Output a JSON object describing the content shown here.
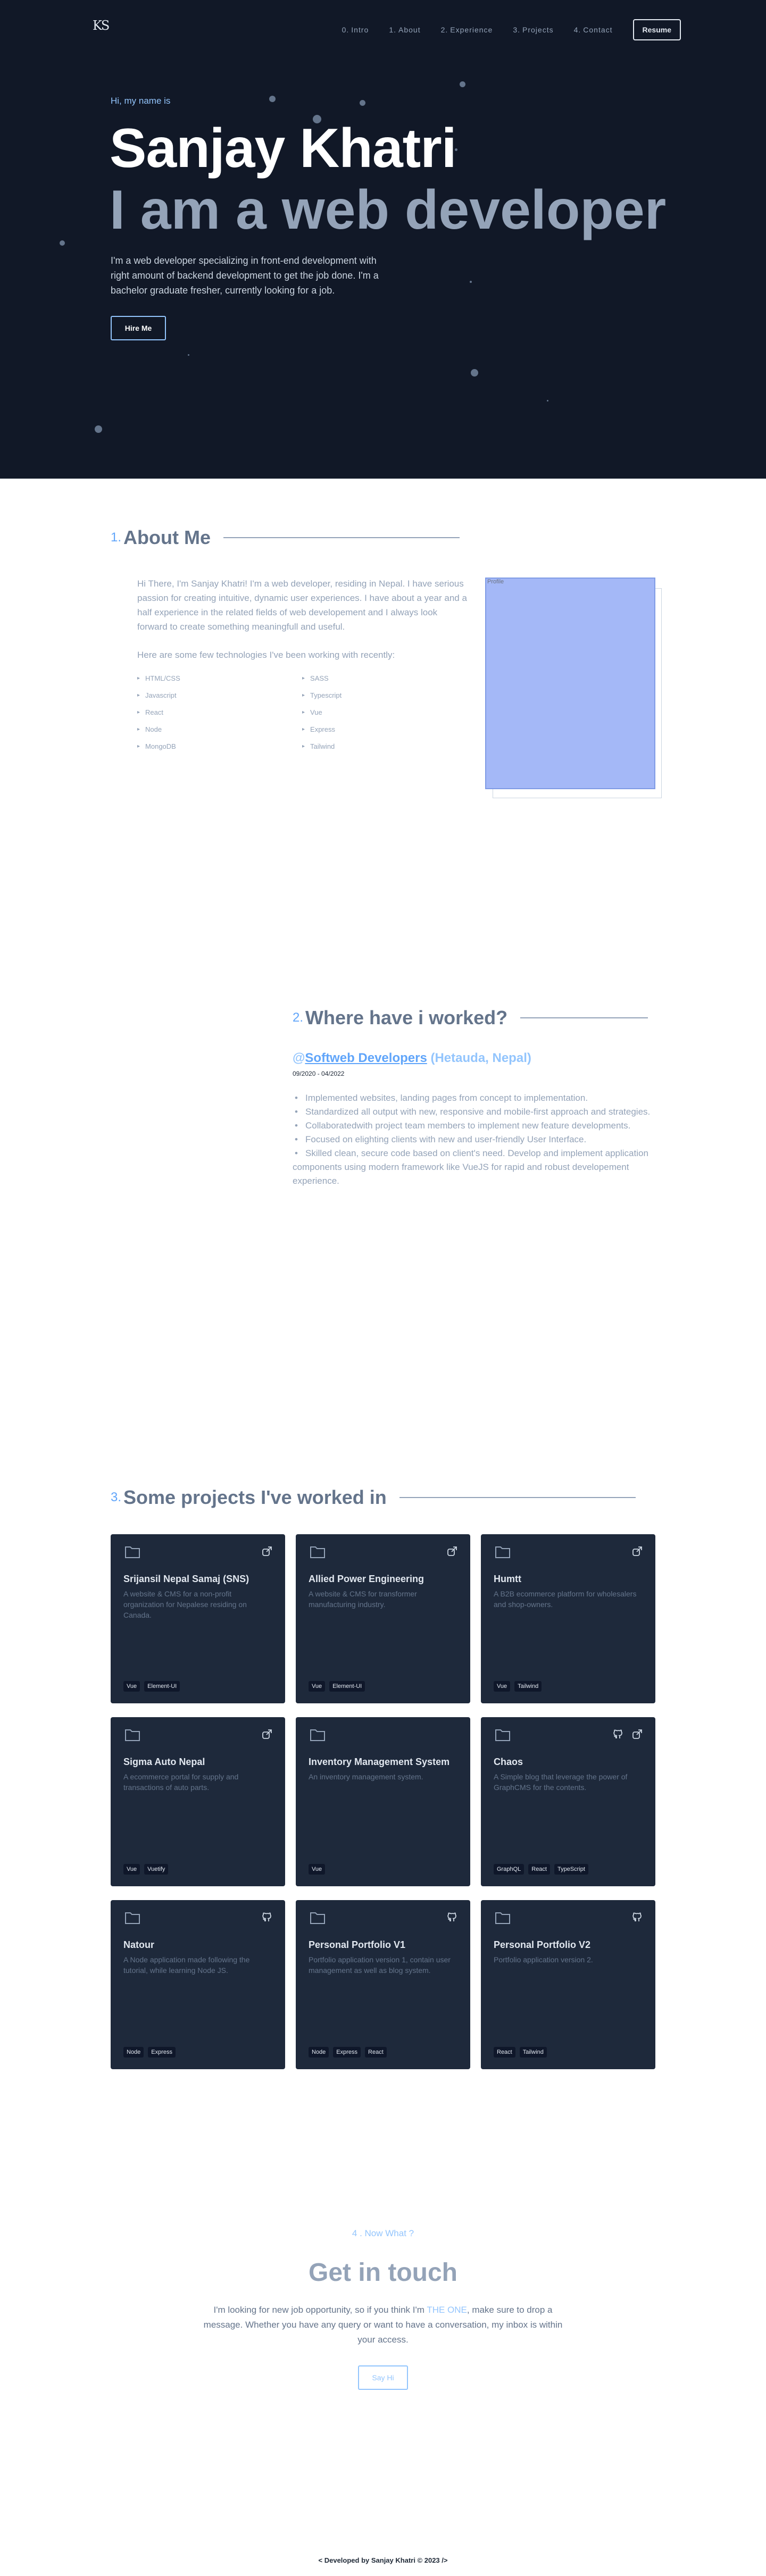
{
  "nav": {
    "logo": "KS",
    "links": [
      {
        "num": "0.",
        "label": "Intro"
      },
      {
        "num": "1.",
        "label": "About"
      },
      {
        "num": "2.",
        "label": "Experience"
      },
      {
        "num": "3.",
        "label": "Projects"
      },
      {
        "num": "4.",
        "label": "Contact"
      }
    ],
    "resume_label": "Resume"
  },
  "hero": {
    "intro": "Hi, my name is",
    "name": "Sanjay Khatri",
    "role": "I am a web developer",
    "description": "I'm a web developer specializing in front-end development with right amount of backend development to get the job done. I'm a bachelor graduate fresher, currently looking for a job.",
    "cta_label": "Hire Me"
  },
  "about": {
    "num": "1.",
    "title": "About Me",
    "text": "Hi There, I'm Sanjay Khatri! I'm a web developer, residing in Nepal. I have serious passion for creating intuitive, dynamic user experiences. I have about a year and a half experience in the related fields of web developement and I always look forward to create something meaningfull and useful.",
    "tech_intro": "Here are some few technologies I've been working with recently:",
    "technologies": [
      "HTML/CSS",
      "SASS",
      "Javascript",
      "Typescript",
      "React",
      "Vue",
      "Node",
      "Express",
      "MongoDB",
      "Tailwind"
    ],
    "photo_alt": "Profile"
  },
  "experience": {
    "num": "2.",
    "title": "Where have i worked?",
    "company_at": "@",
    "company_name": "Softweb Developers",
    "company_location": "(Hetauda, Nepal)",
    "period": "09/2020 - 04/2022",
    "duties": [
      "Implemented websites, landing pages from concept to implementation.",
      "Standardized all output with new, responsive and mobile-first approach and strategies.",
      "Collaboratedwith project team members to implement new feature developments.",
      "Focused on elighting clients with new and user-friendly User Interface.",
      "Skilled clean, secure code based on client's need. Develop and implement application components using modern framework like VueJS for rapid and robust developement experience."
    ]
  },
  "projects": {
    "num": "3.",
    "title": "Some projects I've worked in",
    "items": [
      {
        "title": "Srijansil Nepal Samaj (SNS)",
        "description": "A website & CMS for a non-profit organization for Nepalese residing on Canada.",
        "tags": [
          "Vue",
          "Element-UI"
        ],
        "icons": [
          "external-link-icon"
        ]
      },
      {
        "title": "Allied Power Engineering",
        "description": "A website & CMS for transformer manufacturing industry.",
        "tags": [
          "Vue",
          "Element-UI"
        ],
        "icons": [
          "external-link-icon"
        ]
      },
      {
        "title": "Humtt",
        "description": "A B2B ecommerce platform for wholesalers and shop-owners.",
        "tags": [
          "Vue",
          "Tailwind"
        ],
        "icons": [
          "external-link-icon"
        ]
      },
      {
        "title": "Sigma Auto Nepal",
        "description": "A ecommerce portal for supply and transactions of auto parts.",
        "tags": [
          "Vue",
          "Vuetify"
        ],
        "icons": [
          "external-link-icon"
        ]
      },
      {
        "title": "Inventory Management System",
        "description": "An inventory management system.",
        "tags": [
          "Vue"
        ],
        "icons": []
      },
      {
        "title": "Chaos",
        "description": "A Simple blog that leverage the power of GraphCMS for the contents.",
        "tags": [
          "GraphQL",
          "React",
          "TypeScript"
        ],
        "icons": [
          "github-icon",
          "external-link-icon"
        ]
      },
      {
        "title": "Natour",
        "description": "A Node application made following the tutorial, while learning Node JS.",
        "tags": [
          "Node",
          "Express"
        ],
        "icons": [
          "github-icon"
        ]
      },
      {
        "title": "Personal Portfolio V1",
        "description": "Portfolio application version 1, contain user management as well as blog system.",
        "tags": [
          "Node",
          "Express",
          "React"
        ],
        "icons": [
          "github-icon"
        ]
      },
      {
        "title": "Personal Portfolio V2",
        "description": "Portfolio application version 2.",
        "tags": [
          "React",
          "Tailwind"
        ],
        "icons": [
          "github-icon"
        ]
      }
    ]
  },
  "contact": {
    "kicker": "4 . Now What ?",
    "title": "Get in touch",
    "body_before": "I'm looking for new job opportunity, so if you think I'm ",
    "body_highlight": "THE ONE",
    "body_after": ", make sure to drop a message. Whether you have any query or want to have a conversation, my inbox is within your access.",
    "cta_label": "Say Hi"
  },
  "footer": {
    "text": "< Developed by Sanjay Khatri © 2023 />"
  },
  "colors": {
    "hero_bg": "#111827",
    "accent": "#93c5fd",
    "card_bg": "#1e293b",
    "photo_placeholder": "#a4b8f7"
  }
}
